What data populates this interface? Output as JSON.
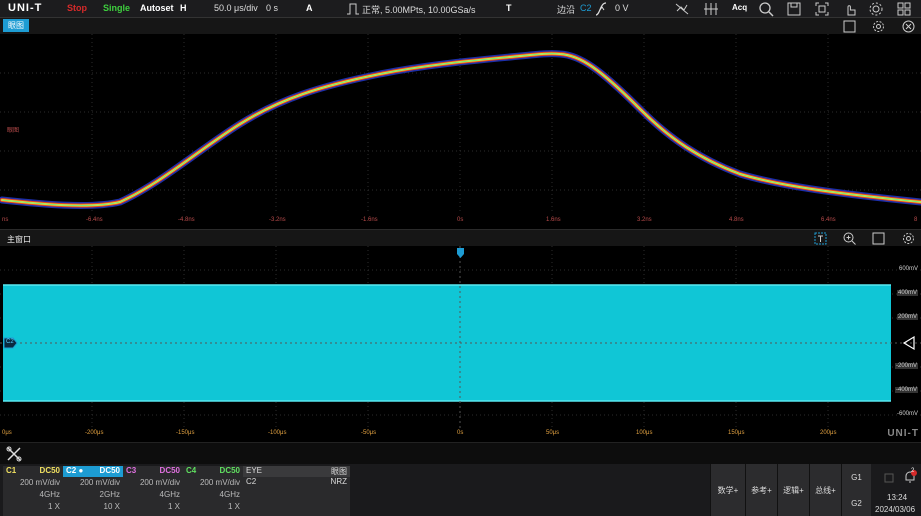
{
  "topbar": {
    "brand": "UNI-T",
    "run_state": "Stop",
    "single": "Single",
    "autoset": "Autoset",
    "h_label": "H",
    "timebase": "50.0 μs/div",
    "h_offset": "0 s",
    "a_label": "A",
    "acq_info": "正常, 5.00MPts, 10.00GSa/s",
    "t_label": "T",
    "trigger_mode": "边沿",
    "trigger_source": "C2",
    "trigger_level": "0 V",
    "acq_btn": "Acq",
    "colors": {
      "run_state": "#d62a2a",
      "single": "#3ecf3e",
      "accent": "#1d9cd3"
    }
  },
  "eye_window": {
    "tab_label": "眼图",
    "side_label": "眼图",
    "x_ticks": [
      "ns",
      "-6.4ns",
      "-4.8ns",
      "-3.2ns",
      "-1.6ns",
      "0s",
      "1.6ns",
      "3.2ns",
      "4.8ns",
      "6.4ns",
      "8"
    ]
  },
  "main_window": {
    "title": "主窗口",
    "channel_marker": "C2",
    "x_ticks": [
      "0μs",
      "-200μs",
      "-150μs",
      "-100μs",
      "-50μs",
      "0s",
      "50μs",
      "100μs",
      "150μs",
      "200μs"
    ],
    "y_ticks": [
      "600mV",
      "400mV",
      "200mV",
      "-200mV",
      "-400mV",
      "-600mV"
    ],
    "watermark": "UNI-T",
    "signal_color": "#10c6d6"
  },
  "channels": [
    {
      "name": "C1",
      "coupling": "DC50",
      "scale": "200 mV/div",
      "bandwidth": "4GHz",
      "probe": "1 X",
      "active": false
    },
    {
      "name": "C2",
      "coupling": "DC50",
      "scale": "200 mV/div",
      "bandwidth": "2GHz",
      "probe": "10 X",
      "active": true
    },
    {
      "name": "C3",
      "coupling": "DC50",
      "scale": "200 mV/div",
      "bandwidth": "4GHz",
      "probe": "1 X",
      "active": false
    },
    {
      "name": "C4",
      "coupling": "DC50",
      "scale": "200 mV/div",
      "bandwidth": "4GHz",
      "probe": "1 X",
      "active": false
    }
  ],
  "eye_info": {
    "name": "EYE",
    "type": "眼图",
    "source": "C2",
    "code": "NRZ"
  },
  "right_buttons": {
    "math": "数学+",
    "ref": "参考+",
    "logic": "逻辑+",
    "bus": "总线+",
    "g1": "G1",
    "g2": "G2"
  },
  "status": {
    "time": "13:24",
    "date": "2024/03/06",
    "notifications": "2"
  }
}
